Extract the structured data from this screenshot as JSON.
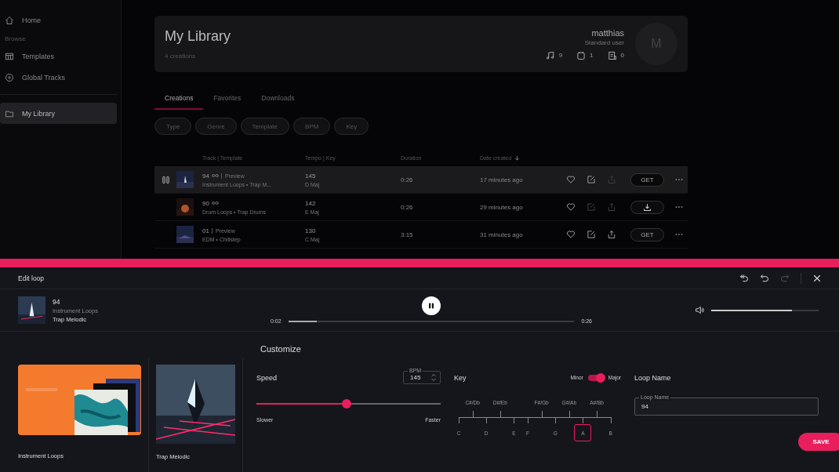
{
  "sidebar": {
    "items": [
      {
        "kind": "link",
        "label": "Home",
        "selected": false
      },
      {
        "kind": "section",
        "label": "Browse"
      },
      {
        "kind": "link",
        "label": "Templates",
        "selected": false
      },
      {
        "kind": "link",
        "label": "Global Tracks",
        "selected": false
      },
      {
        "kind": "link",
        "label": "My Library",
        "selected": true
      }
    ]
  },
  "header": {
    "title": "My Library",
    "subtitle": "4 creations",
    "user": "matthias",
    "role": "Standard user",
    "avatar": "M",
    "stats": [
      "9",
      "1",
      "0"
    ]
  },
  "tabs": [
    {
      "label": "Creations",
      "selected": true
    },
    {
      "label": "Favorites",
      "selected": false
    },
    {
      "label": "Downloads",
      "selected": false
    }
  ],
  "filters": [
    "Type",
    "Genre",
    "Template",
    "BPM",
    "Key"
  ],
  "table": {
    "columns": [
      "Track | Template",
      "Tempo | Key",
      "Duration",
      "Date created"
    ],
    "rows": [
      {
        "selected": true,
        "playing": true,
        "name": "94",
        "looped": true,
        "badge": "Preview",
        "template": "Instrument Loops • Trap M...",
        "tempo": "145",
        "key": "D Maj",
        "duration": "0:26",
        "date": "17 minutes ago",
        "edit_enabled": true,
        "share_enabled": false,
        "action": {
          "kind": "get",
          "label": "GET"
        }
      },
      {
        "selected": false,
        "playing": false,
        "name": "90",
        "looped": true,
        "template": "Drum Loops • Trap Drums",
        "tempo": "142",
        "key": "E Maj",
        "duration": "0:26",
        "date": "29 minutes ago",
        "edit_enabled": false,
        "share_enabled": false,
        "action": {
          "kind": "download"
        }
      },
      {
        "selected": false,
        "playing": false,
        "name": "01",
        "looped": false,
        "badge": "Preview",
        "template": "EDM • Chillstep",
        "tempo": "130",
        "key": "C Maj",
        "duration": "3:15",
        "date": "31 minutes ago",
        "edit_enabled": true,
        "share_enabled": true,
        "action": {
          "kind": "get",
          "label": "GET"
        }
      }
    ]
  },
  "editor": {
    "title": "Edit loop",
    "redo_enabled": false,
    "player": {
      "title": "94",
      "template": "Instrument Loops",
      "genre": "Trap Melodic",
      "elapsed": "0:02",
      "total": "0:26",
      "level": 0.1,
      "playing": true,
      "volume": {
        "level": 0.75
      }
    },
    "heading": "Customize",
    "cards": [
      {
        "label": "Instrument Loops",
        "kind": "picture"
      },
      {
        "label": "Trap Melodic",
        "kind": "picture"
      }
    ],
    "speed": {
      "label": "Speed",
      "bpm_label": "BPM",
      "bpm": "145",
      "level": 0.49,
      "min_label": "Slower",
      "max_label": "Faster"
    },
    "key": {
      "label": "Key",
      "minor_label": "Minor",
      "major_label": "Major",
      "major": true,
      "notes": [
        {
          "name": "C",
          "kind": "natural",
          "selected": false
        },
        {
          "name": "C#/Db",
          "kind": "sharp",
          "selected": false
        },
        {
          "name": "D",
          "kind": "natural",
          "selected": false
        },
        {
          "name": "D#/Eb",
          "kind": "sharp",
          "selected": false
        },
        {
          "name": "E",
          "kind": "natural",
          "selected": false
        },
        {
          "name": "F",
          "kind": "natural",
          "selected": false
        },
        {
          "name": "F#/Gb",
          "kind": "sharp",
          "selected": false
        },
        {
          "name": "G",
          "kind": "natural",
          "selected": false
        },
        {
          "name": "G#/Ab",
          "kind": "sharp",
          "selected": false
        },
        {
          "name": "A",
          "kind": "natural",
          "selected": true
        },
        {
          "name": "A#/Bb",
          "kind": "sharp",
          "selected": false
        },
        {
          "name": "B",
          "kind": "natural",
          "selected": false
        }
      ]
    },
    "loop_name": {
      "heading": "Loop Name",
      "label": "Loop Name",
      "value": "94"
    },
    "save": "SAVE"
  }
}
